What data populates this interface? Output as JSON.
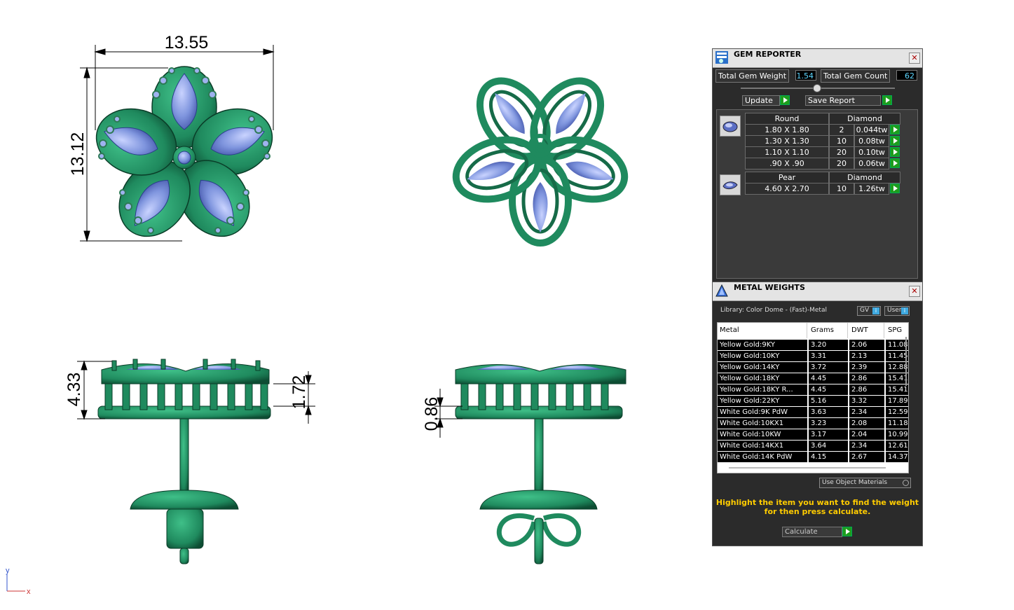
{
  "drawing": {
    "dim_width_top": "13.55",
    "dim_height_left": "13.12",
    "dim_side_height": "4.33",
    "dim_side_inner": "1.72",
    "dim_back_gap": "0.86",
    "axis_y": "y",
    "axis_x": "x"
  },
  "colors": {
    "metal": "#1f8a5e",
    "gem": "#7f95de",
    "panel_bg": "#2b2b2b",
    "accent_value": "#5dd6ff",
    "note": "#ffcc00"
  },
  "gem_reporter": {
    "title": "GEM REPORTER",
    "total_weight_label": "Total Gem Weight",
    "total_weight_value": "1.54",
    "total_count_label": "Total Gem Count",
    "total_count_value": "62",
    "update_label": "Update",
    "save_report_label": "Save Report",
    "groups": [
      {
        "shape": "Round",
        "material": "Diamond",
        "rows": [
          {
            "size": "1.80 X 1.80",
            "count": "2",
            "weight": "0.044tw"
          },
          {
            "size": "1.30 X 1.30",
            "count": "10",
            "weight": "0.08tw"
          },
          {
            "size": "1.10 X 1.10",
            "count": "20",
            "weight": "0.10tw"
          },
          {
            "size": ".90 X .90",
            "count": "20",
            "weight": "0.06tw"
          }
        ]
      },
      {
        "shape": "Pear",
        "material": "Diamond",
        "rows": [
          {
            "size": "4.60 X 2.70",
            "count": "10",
            "weight": "1.26tw"
          }
        ]
      }
    ]
  },
  "metal_weights": {
    "title": "METAL WEIGHTS",
    "library_label": "Library: Color Dome - (Fast)-Metal",
    "gv_label": "GV",
    "user_label": "User",
    "columns": [
      "Metal",
      "Grams",
      "DWT",
      "SPG"
    ],
    "rows": [
      [
        "Yellow Gold:9KY",
        "3.20",
        "2.06",
        "11.08"
      ],
      [
        "Yellow Gold:10KY",
        "3.31",
        "2.13",
        "11.45"
      ],
      [
        "Yellow Gold:14KY",
        "3.72",
        "2.39",
        "12.88"
      ],
      [
        "Yellow Gold:18KY",
        "4.45",
        "2.86",
        "15.41"
      ],
      [
        "Yellow Gold:18KY R...",
        "4.45",
        "2.86",
        "15.41"
      ],
      [
        "Yellow Gold:22KY",
        "5.16",
        "3.32",
        "17.89"
      ],
      [
        "White Gold:9K PdW",
        "3.63",
        "2.34",
        "12.59"
      ],
      [
        "White Gold:10KX1",
        "3.23",
        "2.08",
        "11.18"
      ],
      [
        "White Gold:10KW",
        "3.17",
        "2.04",
        "10.99"
      ],
      [
        "White Gold:14KX1",
        "3.64",
        "2.34",
        "12.61"
      ],
      [
        "White Gold:14K PdW",
        "4.15",
        "2.67",
        "14.37"
      ]
    ],
    "use_object_materials_label": "Use Object Materials",
    "note_line1": "Highlight the item you want to find the weight",
    "note_line2": "for then press calculate.",
    "calculate_label": "Calculate"
  }
}
